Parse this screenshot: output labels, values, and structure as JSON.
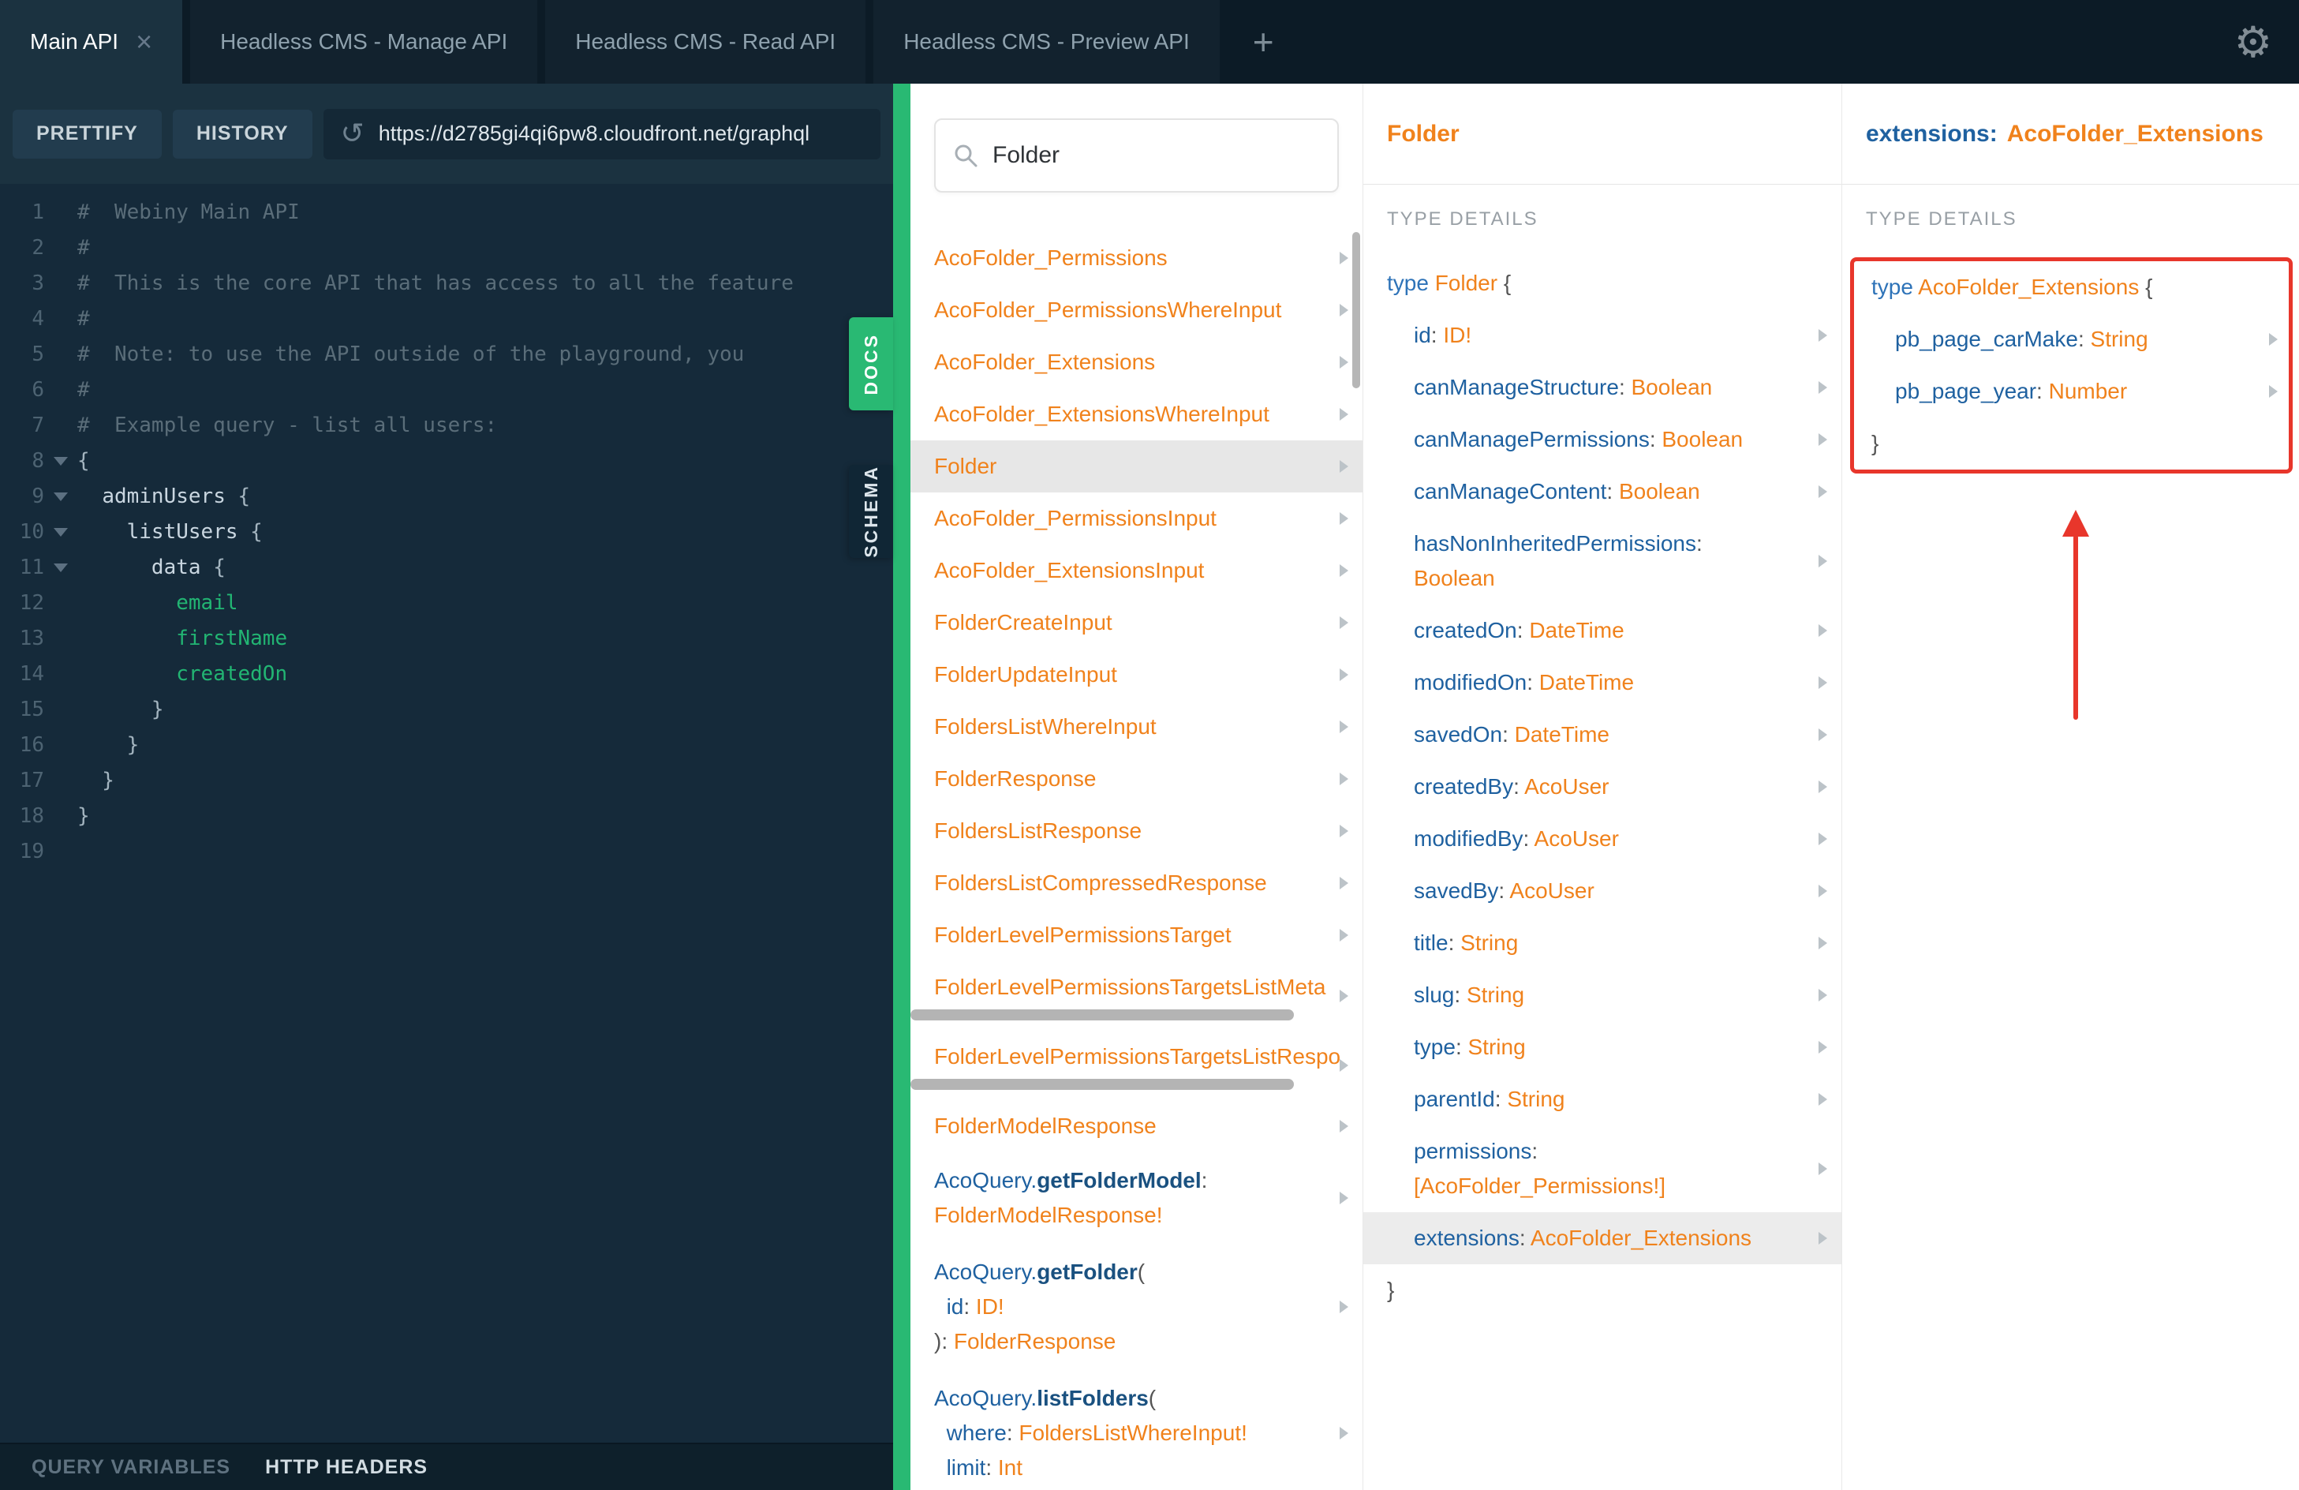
{
  "colors": {
    "green": "#29b973",
    "orange": "#f0821c",
    "blue": "#1f61a0",
    "red": "#e8362b"
  },
  "icons": {
    "gear": "⚙",
    "refresh": "↺",
    "close": "×",
    "add": "+"
  },
  "tabs": {
    "items": [
      {
        "label": "Main API",
        "active": true
      },
      {
        "label": "Headless CMS - Manage API",
        "active": false
      },
      {
        "label": "Headless CMS - Read API",
        "active": false
      },
      {
        "label": "Headless CMS - Preview API",
        "active": false
      }
    ]
  },
  "toolbar": {
    "prettify": "PRETTIFY",
    "history": "HISTORY",
    "url": "https://d2785gi4qi6pw8.cloudfront.net/graphql"
  },
  "side_tabs": {
    "docs": "DOCS",
    "schema": "SCHEMA"
  },
  "footer": {
    "query_variables": "QUERY VARIABLES",
    "http_headers": "HTTP HEADERS"
  },
  "search": {
    "value": "Folder"
  },
  "editor": {
    "lines": [
      {
        "n": 1,
        "fold": false,
        "segs": [
          {
            "t": "#  Webiny Main API",
            "c": "cmt"
          }
        ]
      },
      {
        "n": 2,
        "fold": false,
        "segs": [
          {
            "t": "#",
            "c": "cmt"
          }
        ]
      },
      {
        "n": 3,
        "fold": false,
        "segs": [
          {
            "t": "#  This is the core API that has access to all the feature",
            "c": "cmt"
          }
        ]
      },
      {
        "n": 4,
        "fold": false,
        "segs": [
          {
            "t": "#",
            "c": "cmt"
          }
        ]
      },
      {
        "n": 5,
        "fold": false,
        "segs": [
          {
            "t": "#  Note: to use the API outside of the playground, you",
            "c": "cmt"
          }
        ]
      },
      {
        "n": 6,
        "fold": false,
        "segs": [
          {
            "t": "#",
            "c": "cmt"
          }
        ]
      },
      {
        "n": 7,
        "fold": false,
        "segs": [
          {
            "t": "#  Example query - list all users:",
            "c": "cmt"
          }
        ]
      },
      {
        "n": 8,
        "fold": true,
        "segs": [
          {
            "t": "{",
            "c": "p"
          }
        ]
      },
      {
        "n": 9,
        "fold": true,
        "segs": [
          {
            "t": "  ",
            "c": "p"
          },
          {
            "t": "adminUsers",
            "c": "field"
          },
          {
            "t": " {",
            "c": "p"
          }
        ]
      },
      {
        "n": 10,
        "fold": true,
        "segs": [
          {
            "t": "    ",
            "c": "p"
          },
          {
            "t": "listUsers",
            "c": "field"
          },
          {
            "t": " {",
            "c": "p"
          }
        ]
      },
      {
        "n": 11,
        "fold": true,
        "segs": [
          {
            "t": "      ",
            "c": "p"
          },
          {
            "t": "data",
            "c": "field"
          },
          {
            "t": " {",
            "c": "p"
          }
        ]
      },
      {
        "n": 12,
        "fold": false,
        "segs": [
          {
            "t": "        ",
            "c": "p"
          },
          {
            "t": "email",
            "c": "leaf"
          }
        ]
      },
      {
        "n": 13,
        "fold": false,
        "segs": [
          {
            "t": "        ",
            "c": "p"
          },
          {
            "t": "firstName",
            "c": "leaf"
          }
        ]
      },
      {
        "n": 14,
        "fold": false,
        "segs": [
          {
            "t": "        ",
            "c": "p"
          },
          {
            "t": "createdOn",
            "c": "leaf"
          }
        ]
      },
      {
        "n": 15,
        "fold": false,
        "segs": [
          {
            "t": "      }",
            "c": "p"
          }
        ]
      },
      {
        "n": 16,
        "fold": false,
        "segs": [
          {
            "t": "    }",
            "c": "p"
          }
        ]
      },
      {
        "n": 17,
        "fold": false,
        "segs": [
          {
            "t": "  }",
            "c": "p"
          }
        ]
      },
      {
        "n": 18,
        "fold": false,
        "segs": [
          {
            "t": "}",
            "c": "p"
          }
        ]
      },
      {
        "n": 19,
        "fold": false,
        "segs": []
      }
    ]
  },
  "docs": {
    "items": [
      {
        "kind": "type",
        "label": "AcoFolder_Permissions"
      },
      {
        "kind": "type",
        "label": "AcoFolder_PermissionsWhereInput"
      },
      {
        "kind": "type",
        "label": "AcoFolder_Extensions"
      },
      {
        "kind": "type",
        "label": "AcoFolder_ExtensionsWhereInput"
      },
      {
        "kind": "type",
        "label": "Folder",
        "selected": true
      },
      {
        "kind": "type",
        "label": "AcoFolder_PermissionsInput"
      },
      {
        "kind": "type",
        "label": "AcoFolder_ExtensionsInput"
      },
      {
        "kind": "type",
        "label": "FolderCreateInput"
      },
      {
        "kind": "type",
        "label": "FolderUpdateInput"
      },
      {
        "kind": "type",
        "label": "FoldersListWhereInput"
      },
      {
        "kind": "type",
        "label": "FolderResponse"
      },
      {
        "kind": "type",
        "label": "FoldersListResponse"
      },
      {
        "kind": "type",
        "label": "FoldersListCompressedResponse"
      },
      {
        "kind": "type",
        "label": "FolderLevelPermissionsTarget"
      },
      {
        "kind": "type",
        "label": "FolderLevelPermissionsTargetsListMeta",
        "scrollx": true
      },
      {
        "kind": "type",
        "label": "FolderLevelPermissionsTargetsListRespo",
        "scrollx": true
      },
      {
        "kind": "type",
        "label": "FolderModelResponse"
      },
      {
        "kind": "query",
        "lines": [
          [
            {
              "t": "AcoQuery.",
              "c": "blue"
            },
            {
              "t": "getFolderModel",
              "c": "fn"
            },
            {
              "t": ":",
              "c": "p"
            }
          ],
          [
            {
              "t": "FolderModelResponse!",
              "c": "orange"
            }
          ]
        ]
      },
      {
        "kind": "query",
        "lines": [
          [
            {
              "t": "AcoQuery.",
              "c": "blue"
            },
            {
              "t": "getFolder",
              "c": "fn"
            },
            {
              "t": "(",
              "c": "p"
            }
          ],
          [
            {
              "t": "  ",
              "c": "p"
            },
            {
              "t": "id",
              "c": "blue"
            },
            {
              "t": ": ",
              "c": "p"
            },
            {
              "t": "ID!",
              "c": "orange"
            }
          ],
          [
            {
              "t": "): ",
              "c": "p"
            },
            {
              "t": "FolderResponse",
              "c": "orange"
            }
          ]
        ]
      },
      {
        "kind": "query",
        "lines": [
          [
            {
              "t": "AcoQuery.",
              "c": "blue"
            },
            {
              "t": "listFolders",
              "c": "fn"
            },
            {
              "t": "(",
              "c": "p"
            }
          ],
          [
            {
              "t": "  ",
              "c": "p"
            },
            {
              "t": "where",
              "c": "blue"
            },
            {
              "t": ": ",
              "c": "p"
            },
            {
              "t": "FoldersListWhereInput!",
              "c": "orange"
            }
          ],
          [
            {
              "t": "  ",
              "c": "p"
            },
            {
              "t": "limit",
              "c": "blue"
            },
            {
              "t": ": ",
              "c": "p"
            },
            {
              "t": "Int",
              "c": "orange"
            }
          ]
        ]
      }
    ]
  },
  "type_pane": {
    "header": "Folder",
    "section": "TYPE DETAILS",
    "open": [
      {
        "t": "type ",
        "c": "kw"
      },
      {
        "t": "Folder",
        "c": "orange"
      },
      {
        "t": " {",
        "c": "p"
      }
    ],
    "fields": [
      {
        "name": "id",
        "type": "ID!"
      },
      {
        "name": "canManageStructure",
        "type": "Boolean"
      },
      {
        "name": "canManagePermissions",
        "type": "Boolean"
      },
      {
        "name": "canManageContent",
        "type": "Boolean"
      },
      {
        "name": "hasNonInheritedPermissions",
        "type": "Boolean",
        "wrap": true
      },
      {
        "name": "createdOn",
        "type": "DateTime"
      },
      {
        "name": "modifiedOn",
        "type": "DateTime"
      },
      {
        "name": "savedOn",
        "type": "DateTime"
      },
      {
        "name": "createdBy",
        "type": "AcoUser"
      },
      {
        "name": "modifiedBy",
        "type": "AcoUser"
      },
      {
        "name": "savedBy",
        "type": "AcoUser"
      },
      {
        "name": "title",
        "type": "String"
      },
      {
        "name": "slug",
        "type": "String"
      },
      {
        "name": "type",
        "type": "String"
      },
      {
        "name": "parentId",
        "type": "String"
      },
      {
        "name": "permissions",
        "type": "[AcoFolder_Permissions!]",
        "wrap": true
      },
      {
        "name": "extensions",
        "type": "AcoFolder_Extensions",
        "highlighted": true
      }
    ],
    "close": "}"
  },
  "extension_pane": {
    "header_field": "extensions:",
    "header_type": "AcoFolder_Extensions",
    "section": "TYPE DETAILS",
    "open": [
      {
        "t": "type ",
        "c": "kw"
      },
      {
        "t": "AcoFolder_Extensions",
        "c": "orange"
      },
      {
        "t": " {",
        "c": "p"
      }
    ],
    "fields": [
      {
        "name": "pb_page_carMake",
        "type": "String"
      },
      {
        "name": "pb_page_year",
        "type": "Number"
      }
    ],
    "close": "}"
  }
}
